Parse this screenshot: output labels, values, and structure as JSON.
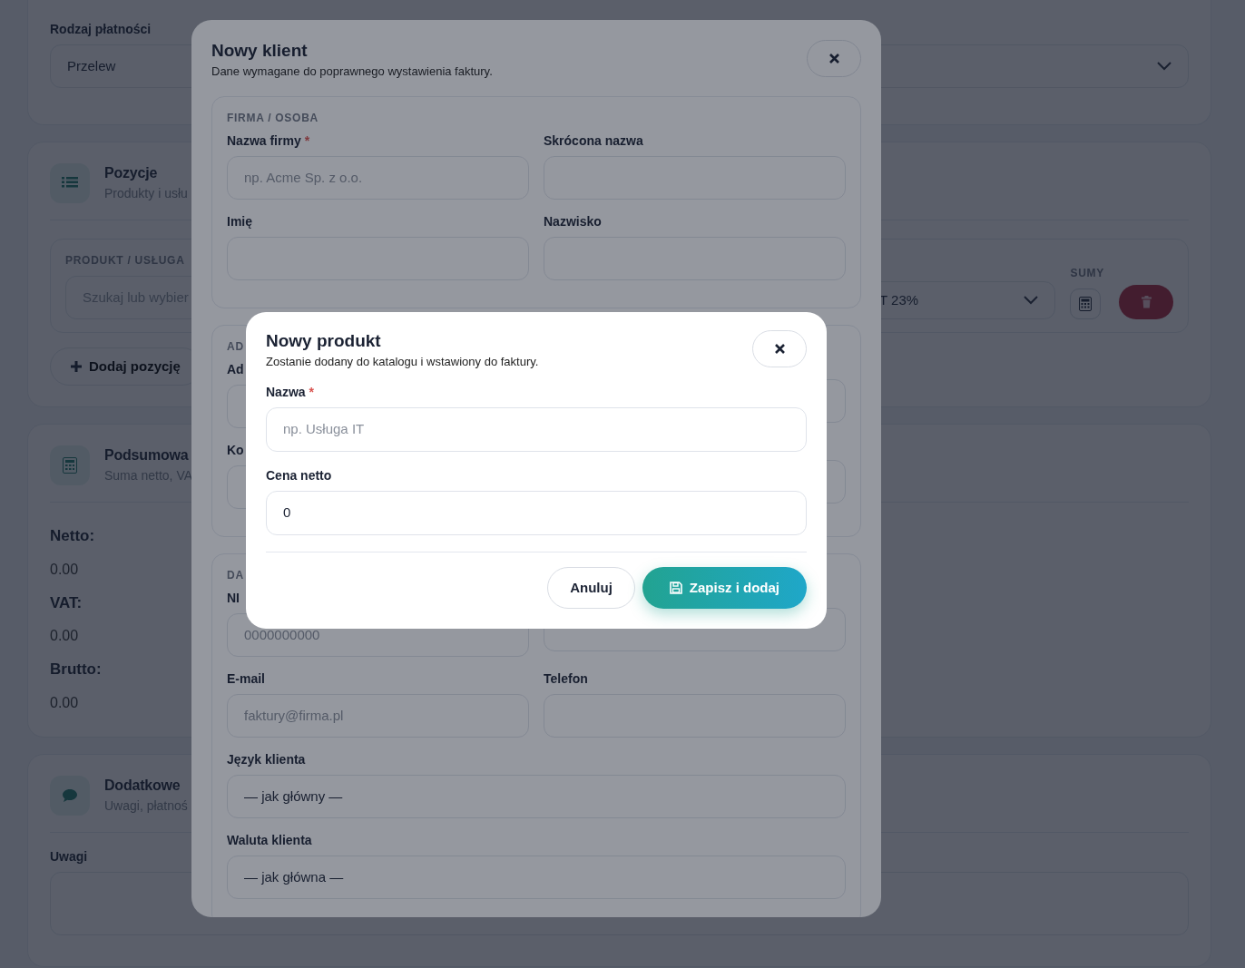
{
  "page": {
    "payment": {
      "label": "Rodzaj płatności",
      "value": "Przelew"
    },
    "items_card": {
      "title": "Pozycje",
      "subtitle": "Produkty i usłu",
      "product_label": "PRODUKT / USŁUGA",
      "search_placeholder": "Szukaj lub wybier",
      "vat_value": "T 23%",
      "sums_label": "SUMY",
      "add_button": "Dodaj pozycję"
    },
    "summary_card": {
      "title": "Podsumowa",
      "subtitle": "Suma netto, VA",
      "totals": [
        {
          "label": "Netto:",
          "value": "0.00"
        },
        {
          "label": "VAT:",
          "value": "0.00"
        },
        {
          "label": "Brutto:",
          "value": "0.00"
        }
      ]
    },
    "extra_card": {
      "title": "Dodatkowe",
      "subtitle": "Uwagi, płatnoś",
      "notes_label": "Uwagi"
    }
  },
  "client_modal": {
    "title": "Nowy klient",
    "subtitle": "Dane wymagane do poprawnego wystawienia faktury.",
    "sections": [
      {
        "heading": "FIRMA / OSOBA",
        "fields": [
          {
            "kind": "input",
            "label": "Nazwa firmy",
            "required_marker": "*",
            "placeholder": "np. Acme Sp. z o.o."
          },
          {
            "kind": "input",
            "label": "Skrócona nazwa"
          },
          {
            "kind": "input",
            "label": "Imię"
          },
          {
            "kind": "input",
            "label": "Nazwisko"
          }
        ]
      },
      {
        "heading": "AD",
        "fields": [
          {
            "kind": "input",
            "label": "Ad"
          },
          {
            "kind": "input"
          },
          {
            "kind": "input",
            "label": "Ko"
          },
          {
            "kind": "input"
          }
        ]
      },
      {
        "heading": "DA",
        "fields": [
          {
            "kind": "input",
            "label": "NI",
            "placeholder": "0000000000"
          },
          {
            "kind": "input"
          },
          {
            "kind": "input",
            "label": "E-mail",
            "placeholder": "faktury@firma.pl"
          },
          {
            "kind": "input",
            "label": "Telefon"
          },
          {
            "kind": "select",
            "label": "Język klienta",
            "value": "— jak główny —"
          },
          {
            "kind": "select",
            "label": "Waluta klienta",
            "value": "— jak główna —"
          }
        ]
      }
    ]
  },
  "product_modal": {
    "title": "Nowy produkt",
    "subtitle": "Zostanie dodany do katalogu i wstawiony do faktury.",
    "fields": [
      {
        "label": "Nazwa",
        "required_marker": "*",
        "placeholder": "np. Usługa IT"
      },
      {
        "label": "Cena netto",
        "value": "0"
      }
    ],
    "buttons": [
      {
        "kind": "secondary",
        "label": "Anuluj"
      },
      {
        "kind": "primary",
        "label": "Zapisz i dodaj"
      }
    ]
  }
}
